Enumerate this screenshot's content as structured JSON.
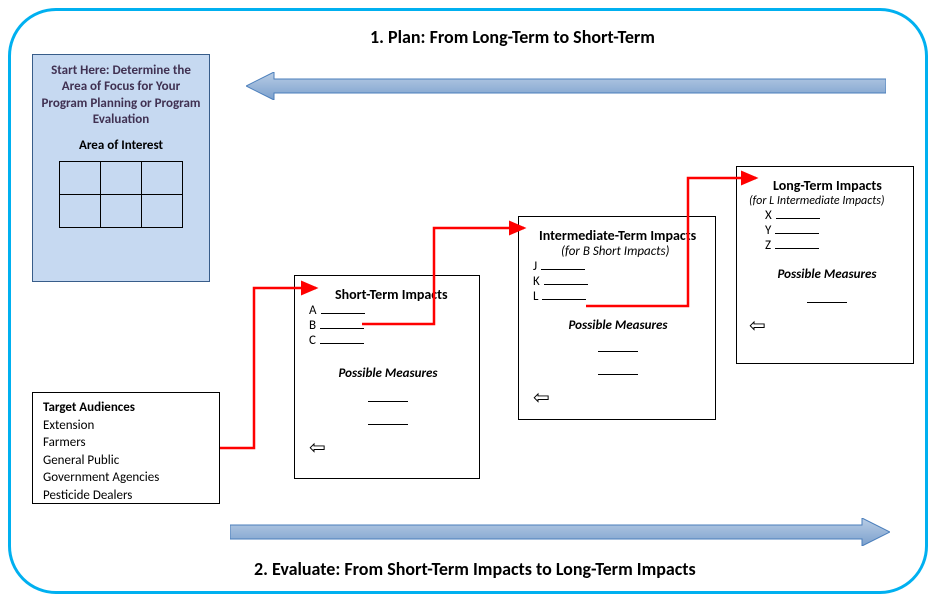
{
  "headings": {
    "plan": "1. Plan:  From Long-Term to Short-Term",
    "evaluate": "2.  Evaluate:  From Short-Term Impacts to Long-Term Impacts"
  },
  "start": {
    "text": "Start Here: Determine the Area of Focus for Your Program Planning or Program Evaluation",
    "aoi": "Area of Interest"
  },
  "audiences": {
    "title": "Target Audiences",
    "items": [
      "Extension",
      "Farmers",
      "General Public",
      "Government Agencies",
      "Pesticide Dealers"
    ]
  },
  "cards": {
    "short": {
      "title": "Short-Term Impacts",
      "labels": [
        "A",
        "B",
        "C"
      ],
      "pm": "Possible Measures"
    },
    "inter": {
      "title": "Intermediate-Term Impacts",
      "sub": "(for B Short Impacts)",
      "labels": [
        "J",
        "K",
        "L"
      ],
      "pm": "Possible Measures"
    },
    "long": {
      "title": "Long-Term Impacts",
      "sub": "(for L Intermediate Impacts)",
      "labels": [
        "X",
        "Y",
        "Z"
      ],
      "pm": "Possible Measures"
    }
  },
  "colors": {
    "frame": "#00B0F0",
    "startFill": "#C6D9F1",
    "startBorder": "#385D8A",
    "startText": "#403152",
    "arrowFill": "#8FAADC",
    "arrowStroke": "#4A7EBB",
    "red": "#FF0000"
  }
}
